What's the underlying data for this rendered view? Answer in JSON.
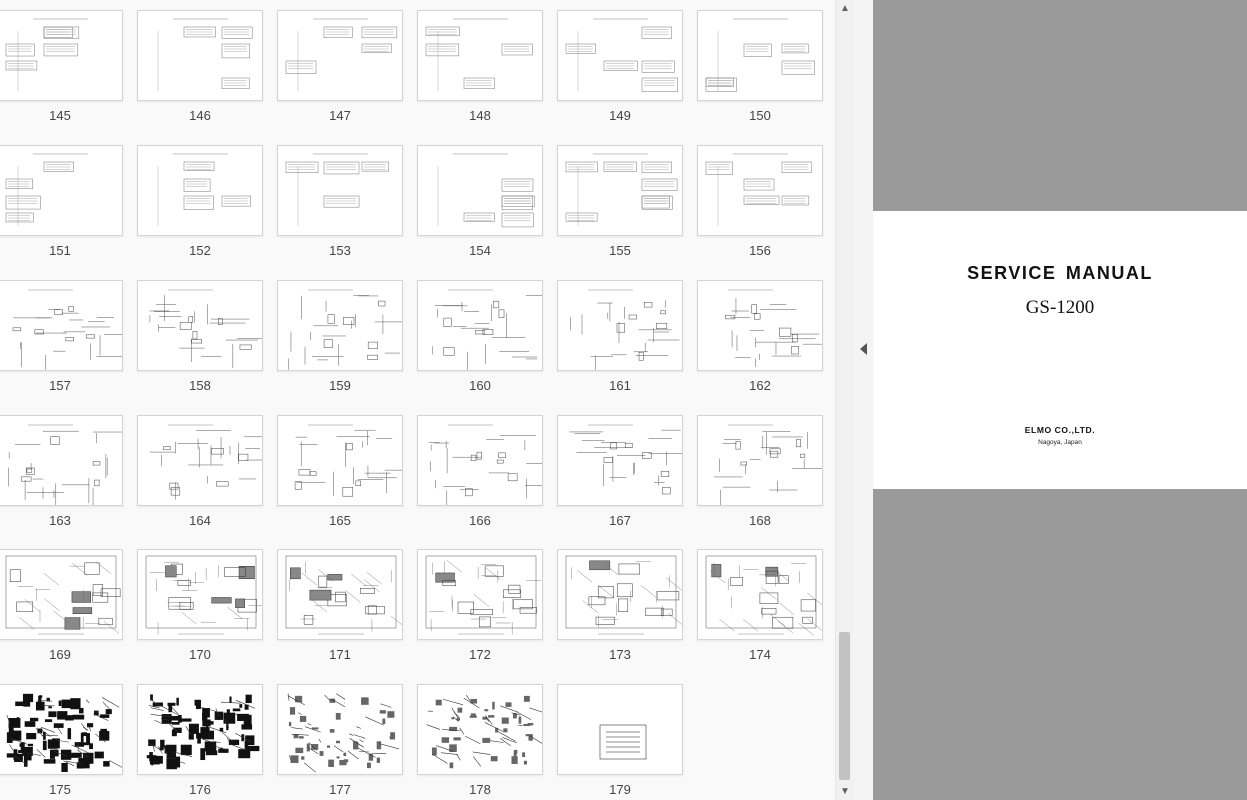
{
  "thumbnails": {
    "rows": [
      {
        "pages": [
          "145",
          "146",
          "147",
          "148",
          "149",
          "150"
        ],
        "style": "text"
      },
      {
        "pages": [
          "151",
          "152",
          "153",
          "154",
          "155",
          "156"
        ],
        "style": "text"
      },
      {
        "pages": [
          "157",
          "158",
          "159",
          "160",
          "161",
          "162"
        ],
        "style": "circuit"
      },
      {
        "pages": [
          "163",
          "164",
          "165",
          "166",
          "167",
          "168"
        ],
        "style": "circuit"
      },
      {
        "pages": [
          "169",
          "170",
          "171",
          "172",
          "173",
          "174"
        ],
        "style": "block"
      },
      {
        "pages": [
          "175",
          "176",
          "177",
          "178",
          "179"
        ],
        "style": "pcb"
      }
    ]
  },
  "icons": {
    "scroll_up": "chevron-up-icon",
    "scroll_down": "chevron-down-icon",
    "collapse": "triangle-left-icon"
  },
  "preview": {
    "title": "SERVICE MANUAL",
    "model": "GS-1200",
    "company": "ELMO CO.,LTD.",
    "location": "Nagoya, Japan"
  },
  "colors": {
    "pane_background": "#f9f9f9",
    "preview_background": "#9a9a9a",
    "scroll_thumb": "#c2c2c2"
  }
}
